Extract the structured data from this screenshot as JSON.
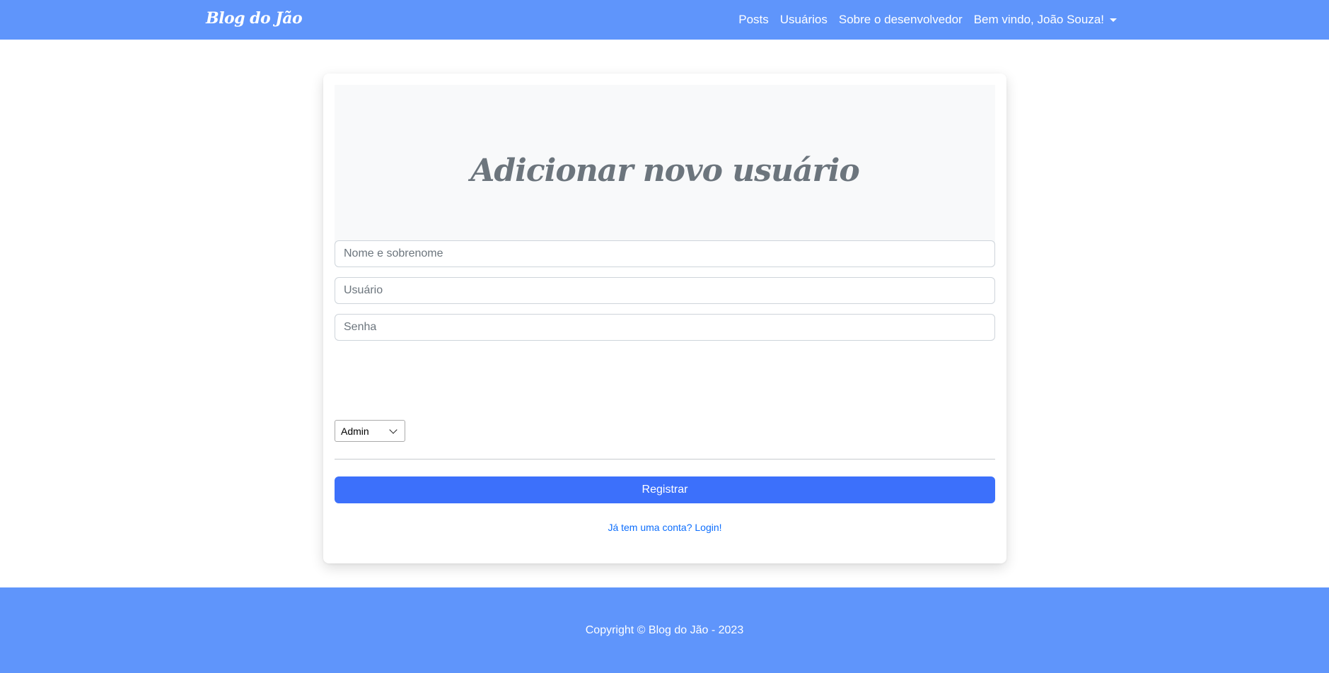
{
  "navbar": {
    "brand": "Blog do Jão",
    "links": {
      "posts": "Posts",
      "users": "Usuários",
      "about": "Sobre o desenvolvedor",
      "welcome": "Bem vindo, João Souza!"
    }
  },
  "form": {
    "title": "Adicionar novo usuário",
    "name_placeholder": "Nome e sobrenome",
    "username_placeholder": "Usuário",
    "password_placeholder": "Senha",
    "role_selected": "Admin",
    "submit_label": "Registrar",
    "login_link": "Já tem uma conta? Login!"
  },
  "footer": {
    "copyright": "Copyright © Blog do Jão - 2023"
  },
  "colors": {
    "primary_bar": "#5f95fb",
    "button": "#3c70fb",
    "link": "#0d6efd"
  },
  "icons": {
    "dropdown_caret": "caret-down-icon",
    "select_chevron": "chevron-down-icon"
  }
}
